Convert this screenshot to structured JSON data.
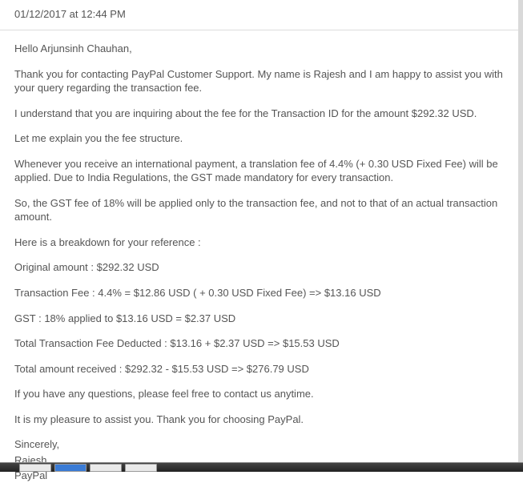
{
  "timestamp": "01/12/2017 at 12:44 PM",
  "greeting": "Hello Arjunsinh Chauhan,",
  "intro": "Thank you for contacting PayPal Customer Support. My name is Rajesh and I am happy to assist you with your query regarding the transaction fee.",
  "understand": "I understand that you are inquiring about the fee for the Transaction ID                                  for the amount $292.32 USD.",
  "explain": "Let me explain you the fee structure.",
  "intl": "Whenever you receive an international payment, a translation fee of 4.4% (+ 0.30 USD Fixed Fee) will be applied. Due to India Regulations, the GST made mandatory for every transaction.",
  "gst_note": "So, the GST fee of 18% will be applied only to the transaction fee, and not to that of an actual transaction amount.",
  "breakdown_head": "Here is a breakdown for your reference :",
  "original": "Original amount : $292.32 USD",
  "txn_fee": "Transaction Fee : 4.4% = $12.86 USD ( + 0.30 USD Fixed Fee) => $13.16 USD",
  "gst": "GST : 18% applied to $13.16 USD = $2.37 USD",
  "total_deducted": "Total Transaction Fee Deducted : $13.16 + $2.37 USD => $15.53 USD",
  "total_received": "Total amount received  : $292.32 - $15.53 USD => $276.79 USD",
  "questions": "If you have any questions, please feel free to contact us anytime.",
  "pleasure": "It is my pleasure to assist you. Thank you for choosing PayPal.",
  "sig1": "Sincerely,",
  "sig2": "Rajesh",
  "sig3": "PayPal"
}
